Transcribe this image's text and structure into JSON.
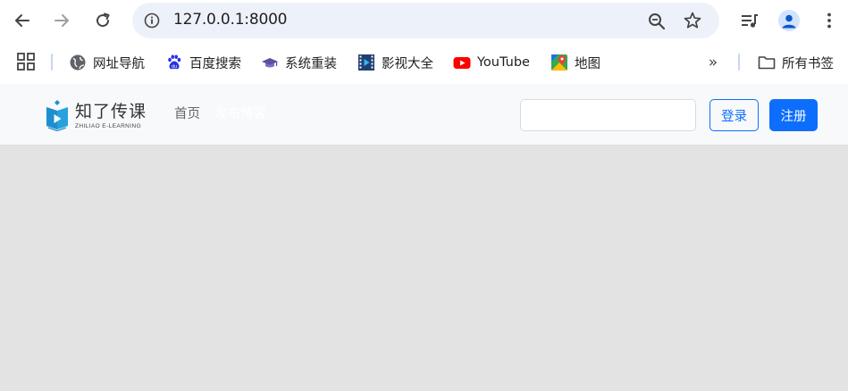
{
  "browser": {
    "url": "127.0.0.1:8000",
    "icons": {
      "back": "back-arrow-icon",
      "forward": "forward-arrow-icon",
      "reload": "reload-icon",
      "info": "info-icon",
      "zoom": "zoom-out-icon",
      "bookmark": "star-icon",
      "media": "media-queue-icon",
      "profile": "profile-icon",
      "menu": "kebab-menu-icon"
    }
  },
  "bookmarks": {
    "items": [
      {
        "label": "网址导航",
        "icon": "globe-icon"
      },
      {
        "label": "百度搜索",
        "icon": "baidu-paw-icon"
      },
      {
        "label": "系统重装",
        "icon": "graduation-cap-icon"
      },
      {
        "label": "影视大全",
        "icon": "film-icon"
      },
      {
        "label": "YouTube",
        "icon": "youtube-icon"
      },
      {
        "label": "地图",
        "icon": "maps-icon"
      }
    ],
    "all_label": "所有书签"
  },
  "site": {
    "logo_cn": "知了传课",
    "logo_en": "ZHILIAO E-LEARNING",
    "nav": {
      "home": "首页",
      "post": "发布博客"
    },
    "search": {
      "value": "",
      "placeholder": ""
    },
    "login_label": "登录",
    "register_label": "注册",
    "colors": {
      "primary": "#0d6efd",
      "navbar_bg": "#f8f9fa",
      "page_bg": "#e3e3e3"
    }
  }
}
